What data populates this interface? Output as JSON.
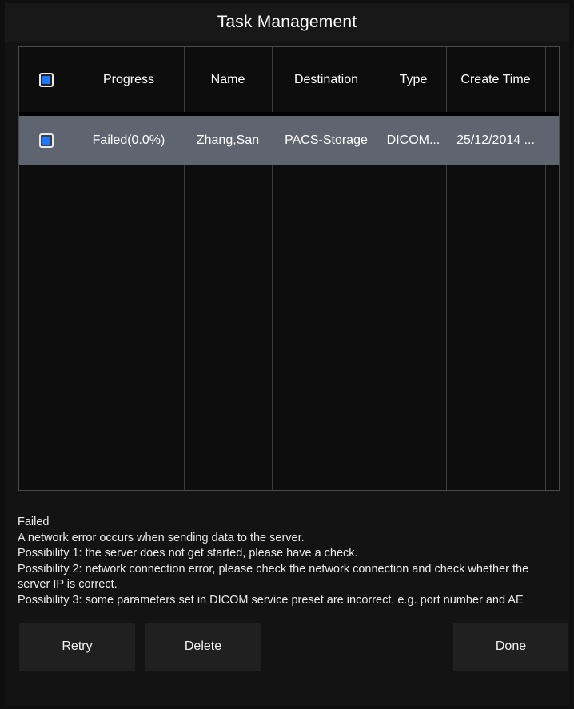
{
  "title": "Task Management",
  "table": {
    "columns": [
      "Progress",
      "Name",
      "Destination",
      "Type",
      "Create Time"
    ],
    "rows": [
      {
        "progress": "Failed(0.0%)",
        "name": "Zhang,San",
        "destination": "PACS-Storage",
        "type": "DICOM...",
        "create_time": "25/12/2014 ..."
      }
    ]
  },
  "details": {
    "status": "Failed",
    "lines": [
      "A network error occurs when sending data to the server.",
      "Possibility 1: the server does not get started, please have a check.",
      "Possibility 2: network connection error, please check the network connection and check whether the server IP is correct.",
      "Possibility 3: some parameters set in DICOM service preset are incorrect, e.g. port number and AE"
    ]
  },
  "buttons": {
    "retry": "Retry",
    "delete": "Delete",
    "done": "Done"
  },
  "colors": {
    "checkbox_fill": "#1e78ff",
    "selected_row": "#5e6470"
  }
}
